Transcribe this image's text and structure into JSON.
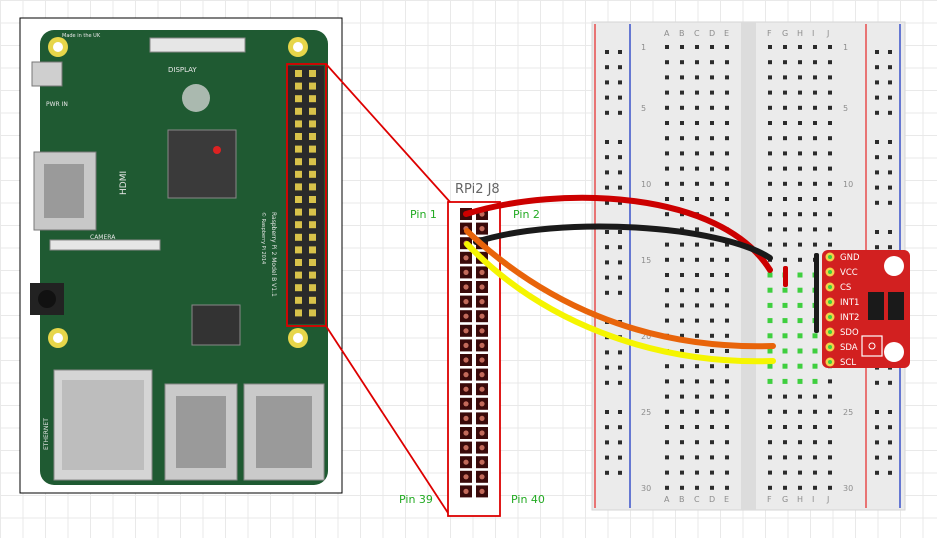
{
  "header": {
    "title": "RPi2 J8"
  },
  "pin_labels": {
    "pin1": "Pin 1",
    "pin2": "Pin 2",
    "pin39": "Pin 39",
    "pin40": "Pin 40"
  },
  "breadboard": {
    "letters_left": [
      "A",
      "B",
      "C",
      "D",
      "E"
    ],
    "letters_right": [
      "F",
      "G",
      "H",
      "I",
      "J"
    ],
    "row_numbers": [
      "1",
      "5",
      "10",
      "15",
      "20",
      "25",
      "30"
    ]
  },
  "sensor": {
    "labels": [
      "GND",
      "VCC",
      "CS",
      "INT1",
      "INT2",
      "SDO",
      "SDA",
      "SCL"
    ]
  },
  "board": {
    "text": {
      "made_in": "Made in the UK",
      "display": "DISPLAY",
      "hdmi": "HDMI",
      "camera": "CAMERA",
      "pwr_in": "PWR IN",
      "ethernet": "ETHERNET",
      "model": "Raspberry Pi 2 Model B V1.1",
      "copyright": "© Raspberry Pi 2014"
    }
  },
  "colors": {
    "wire_red": "#cc0000",
    "wire_black": "#1a1a1a",
    "wire_orange": "#e8640a",
    "wire_yellow": "#f5f500",
    "pcb": "#1f5a32",
    "sensor_board": "#d22020",
    "outline_red": "#dd0000",
    "label_green": "#22aa22"
  }
}
